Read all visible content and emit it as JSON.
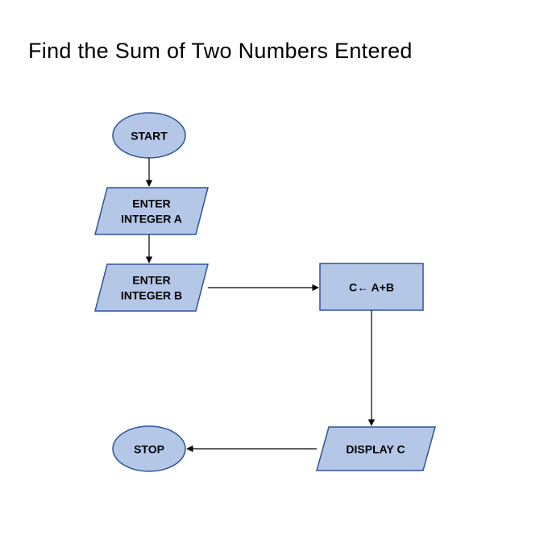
{
  "title": "Find the Sum of Two Numbers Entered",
  "nodes": {
    "start": {
      "label": "START"
    },
    "inputA": {
      "line1": "ENTER",
      "line2": "INTEGER A"
    },
    "inputB": {
      "line1": "ENTER",
      "line2": "INTEGER B"
    },
    "process": {
      "label": "C← A+B"
    },
    "output": {
      "label": "DISPLAY C"
    },
    "stop": {
      "label": "STOP"
    }
  },
  "flow": [
    [
      "start",
      "inputA"
    ],
    [
      "inputA",
      "inputB"
    ],
    [
      "inputB",
      "process"
    ],
    [
      "process",
      "output"
    ],
    [
      "output",
      "stop"
    ]
  ],
  "colors": {
    "fill": "#b4c7e7",
    "stroke": "#2e5597"
  }
}
